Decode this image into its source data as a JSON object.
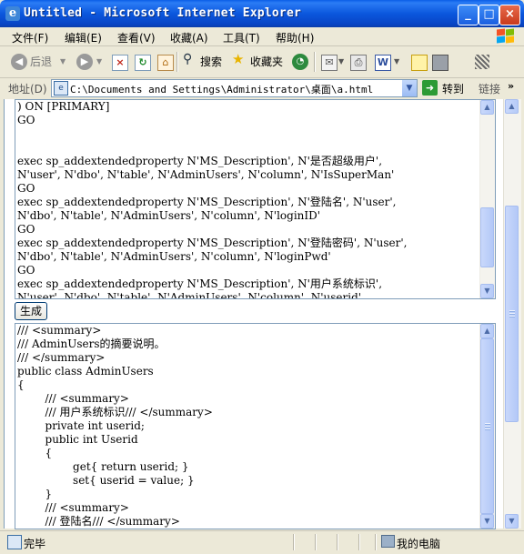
{
  "window": {
    "title": "Untitled - Microsoft Internet Explorer",
    "minimize_glyph": "_",
    "maximize_glyph": "□",
    "close_glyph": "×"
  },
  "menu": {
    "items": [
      "文件(F)",
      "编辑(E)",
      "查看(V)",
      "收藏(A)",
      "工具(T)",
      "帮助(H)"
    ]
  },
  "toolbar": {
    "back_label": "后退",
    "search_label": "搜索",
    "favorites_label": "收藏夹"
  },
  "address": {
    "label": "地址(D)",
    "value": "C:\\Documents and Settings\\Administrator\\桌面\\a.html",
    "go_label": "转到",
    "links_label": "链接"
  },
  "sql_textarea": {
    "lines": [
      ") ON [PRIMARY]",
      "GO",
      "",
      "",
      "exec sp_addextendedproperty N'MS_Description', N'是否超级用户',",
      "N'user', N'dbo', N'table', N'AdminUsers', N'column', N'IsSuperMan'",
      "GO",
      "exec sp_addextendedproperty N'MS_Description', N'登陆名', N'user',",
      "N'dbo', N'table', N'AdminUsers', N'column', N'loginID'",
      "GO",
      "exec sp_addextendedproperty N'MS_Description', N'登陆密码', N'user',",
      "N'dbo', N'table', N'AdminUsers', N'column', N'loginPwd'",
      "GO",
      "exec sp_addextendedproperty N'MS_Description', N'用户系统标识',",
      "N'user', N'dbo', N'table', N'AdminUsers', N'column', N'userid'"
    ]
  },
  "generate_button": {
    "label": "生成"
  },
  "code_textarea": {
    "lines": [
      "/// <summary>",
      "/// AdminUsers的摘要说明。",
      "/// </summary>",
      "public class AdminUsers",
      "{",
      "        /// <summary>",
      "        /// 用户系统标识/// </summary>",
      "        private int userid;",
      "        public int Userid",
      "        {",
      "                get{ return userid; }",
      "                set{ userid = value; }",
      "        }",
      "        /// <summary>",
      "        /// 登陆名/// </summary>"
    ]
  },
  "status": {
    "text": "完毕",
    "zone": "我的电脑"
  },
  "colors": {
    "titlebar": "#0b57dd",
    "chrome": "#ece9d8",
    "border": "#7f9db9",
    "scrollbar": "#c9d8fb"
  }
}
